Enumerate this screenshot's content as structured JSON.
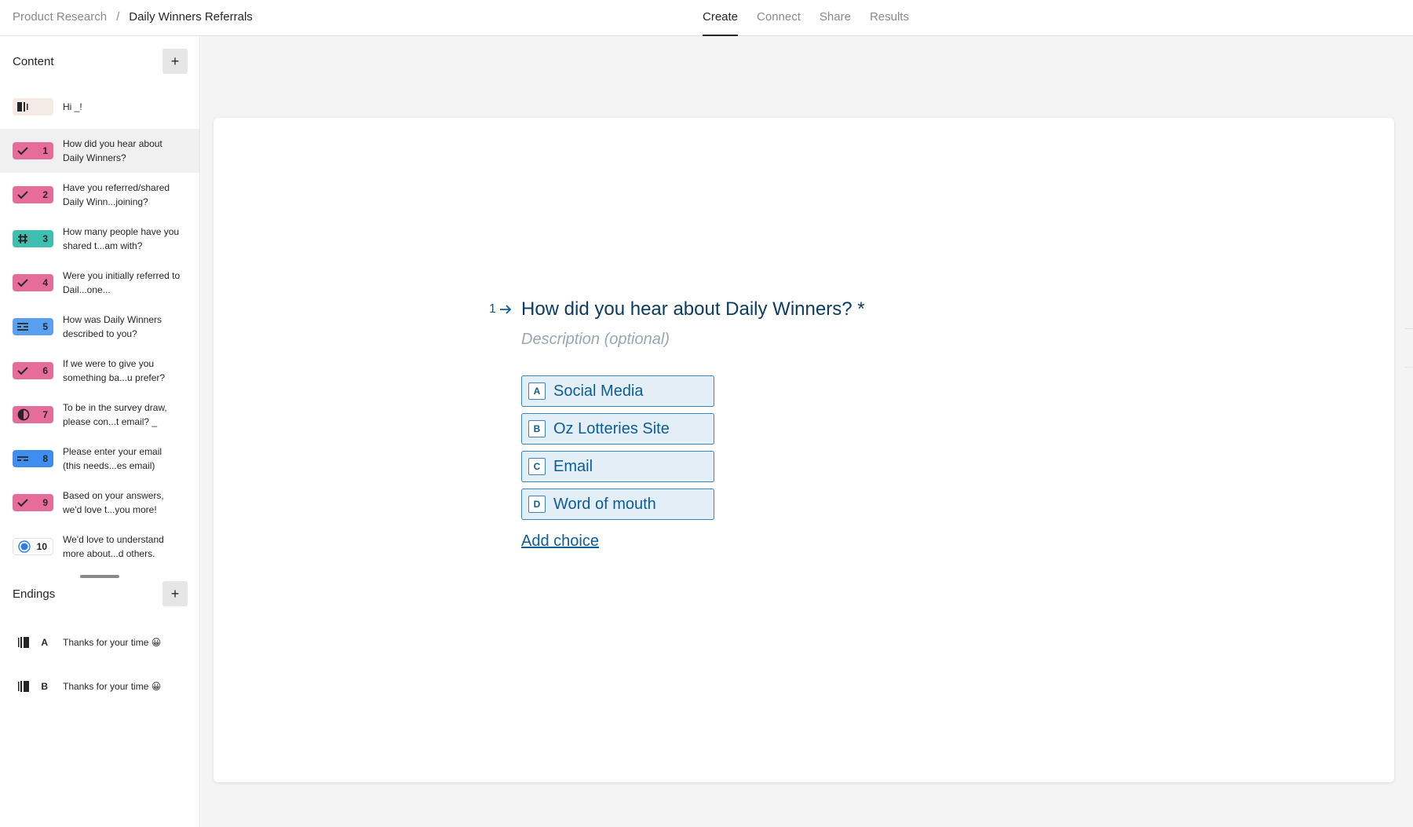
{
  "breadcrumb": {
    "parent": "Product Research",
    "separator": "/",
    "current": "Daily Winners Referrals"
  },
  "tabs": [
    "Create",
    "Connect",
    "Share",
    "Results"
  ],
  "active_tab": "Create",
  "sidebar": {
    "content_title": "Content",
    "add_label": "+",
    "items": [
      {
        "type": "welcome",
        "icon": "welcome-screen-icon",
        "color": "#f2ebe6",
        "number": "",
        "text": "Hi _!"
      },
      {
        "type": "multiple-choice",
        "icon": "check-icon",
        "color": "#e66d9a",
        "number": "1",
        "text": "How did you hear about Daily Winners?"
      },
      {
        "type": "multiple-choice",
        "icon": "check-icon",
        "color": "#e66d9a",
        "number": "2",
        "text": "Have you referred/shared Daily Winn...joining?"
      },
      {
        "type": "number",
        "icon": "hash-icon",
        "color": "#3fbfb0",
        "number": "3",
        "text": "How many people have you shared t...am with?"
      },
      {
        "type": "multiple-choice",
        "icon": "check-icon",
        "color": "#e66d9a",
        "number": "4",
        "text": "Were you initially referred to Dail...one..."
      },
      {
        "type": "long-text",
        "icon": "long-text-icon",
        "color": "#5aa0f0",
        "number": "5",
        "text": "How was Daily Winners described to you?"
      },
      {
        "type": "multiple-choice",
        "icon": "check-icon",
        "color": "#e66d9a",
        "number": "6",
        "text": "If we were to give you something ba...u prefer?"
      },
      {
        "type": "legal",
        "icon": "contrast-icon",
        "color": "#e66d9a",
        "number": "7",
        "text": "To be in the survey draw, please con...t email? _"
      },
      {
        "type": "email",
        "icon": "short-text-icon",
        "color": "#3d8ef0",
        "number": "8",
        "text": "Please enter your email (this needs...es email)"
      },
      {
        "type": "multiple-choice",
        "icon": "check-icon",
        "color": "#e66d9a",
        "number": "9",
        "text": "Based on your answers, we'd love t...you more!"
      },
      {
        "type": "statement",
        "icon": "target-icon",
        "color": "#ffffff",
        "number": "10",
        "text": "We'd love to understand more about...d others."
      }
    ],
    "endings_title": "Endings",
    "endings": [
      {
        "icon": "ending-screen-icon",
        "letter": "A",
        "text": "Thanks for your time 😀"
      },
      {
        "icon": "ending-screen-icon",
        "letter": "B",
        "text": "Thanks for your time 😀"
      }
    ]
  },
  "question": {
    "number": "1",
    "title": "How did you hear about Daily Winners? *",
    "description_placeholder": "Description (optional)",
    "choices": [
      {
        "key": "A",
        "label": "Social Media"
      },
      {
        "key": "B",
        "label": "Oz Lotteries Site"
      },
      {
        "key": "C",
        "label": "Email"
      },
      {
        "key": "D",
        "label": "Word of mouth"
      }
    ],
    "add_choice_label": "Add choice"
  }
}
